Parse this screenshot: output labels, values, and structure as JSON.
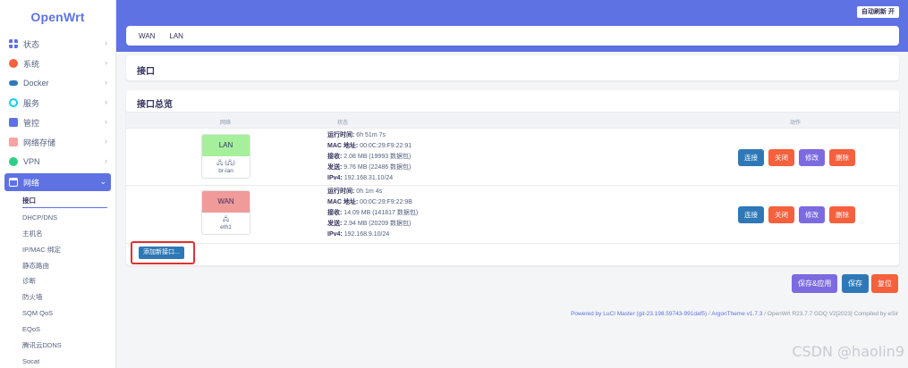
{
  "brand": "OpenWrt",
  "refresh_label": "自动刷新 开",
  "menu": [
    {
      "label": "状态",
      "icon": "dashboard-icon",
      "color": "#5e72e4"
    },
    {
      "label": "系统",
      "icon": "gear-icon",
      "color": "#f5603d"
    },
    {
      "label": "Docker",
      "icon": "docker-icon",
      "color": "#2e78b7"
    },
    {
      "label": "服务",
      "icon": "link-icon",
      "color": "#11cdef"
    },
    {
      "label": "管控",
      "icon": "clipboard-icon",
      "color": "#5e72e4"
    },
    {
      "label": "网络存储",
      "icon": "storage-icon",
      "color": "#f5a3a3"
    },
    {
      "label": "VPN",
      "icon": "vpn-icon",
      "color": "#2dce89"
    }
  ],
  "network_menu_label": "网络",
  "submenu": [
    "接口",
    "DHCP/DNS",
    "主机名",
    "IP/MAC 绑定",
    "静态路由",
    "诊断",
    "防火墙",
    "SQM QoS",
    "EQoS",
    "腾讯云DDNS",
    "Socat"
  ],
  "tabs": [
    "WAN",
    "LAN"
  ],
  "page_title": "接口",
  "overview_title": "接口总览",
  "columns": {
    "network": "网络",
    "status": "状态",
    "actions": "动作"
  },
  "interfaces": [
    {
      "name": "LAN",
      "color": "#a7f09b",
      "device_icons": "🖧 (🖧)",
      "device": "br-lan",
      "uptime_label": "运行时间:",
      "uptime": "6h 51m 7s",
      "mac_label": "MAC 地址:",
      "mac": "00:0C:29:F9:22:91",
      "rx_label": "接收:",
      "rx": "2.08 MB (19993 数据包)",
      "tx_label": "发送:",
      "tx": "9.76 MB (22486 数据包)",
      "ipv4_label": "IPv4:",
      "ipv4": "192.168.31.10/24"
    },
    {
      "name": "WAN",
      "color": "#f09a9a",
      "device_icons": "🖧",
      "device": "eth1",
      "uptime_label": "运行时间:",
      "uptime": "0h 1m 4s",
      "mac_label": "MAC 地址:",
      "mac": "00:0C:29:F9:22:9B",
      "rx_label": "接收:",
      "rx": "14.09 MB (141817 数据包)",
      "tx_label": "发送:",
      "tx": "2.94 MB (20209 数据包)",
      "ipv4_label": "IPv4:",
      "ipv4": "192.168.9.10/24"
    }
  ],
  "row_actions": {
    "connect": "连接",
    "stop": "关闭",
    "edit": "修改",
    "delete": "删除"
  },
  "add_interface": "添加新接口...",
  "bottom": {
    "save_apply": "保存&应用",
    "save": "保存",
    "reset": "复位"
  },
  "footer": {
    "powered": "Powered by LuCI Master (git-23.198.59743-991daf5)",
    "sep1": " / ",
    "theme": "ArgonTheme v1.7.3",
    "rest": " / OpenWrt R23.7.7 GDQ V2[2023] Compiled by eSir"
  },
  "watermark": "CSDN @haolin9"
}
